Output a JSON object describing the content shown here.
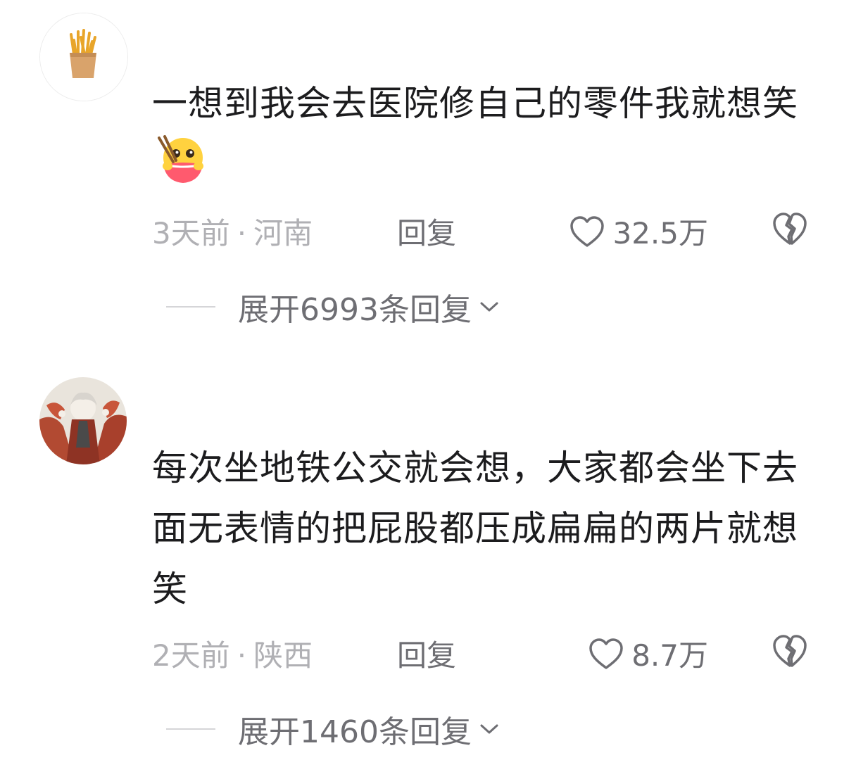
{
  "comments": [
    {
      "avatar_icon": "french-fries-icon",
      "text": "一想到我会去医院修自己的零件我就想笑",
      "emoji_icon": "happy-eating-emoji-icon",
      "time": "3天前",
      "separator": "·",
      "location": "河南",
      "reply_label": "回复",
      "like_count": "32.5万",
      "expand_label": "展开6993条回复"
    },
    {
      "avatar_icon": "anime-character-avatar",
      "text": "每次坐地铁公交就会想，大家都会坐下去面无表情的把屁股都压成扁扁的两片就想笑",
      "time": "2天前",
      "separator": "·",
      "location": "陕西",
      "reply_label": "回复",
      "like_count": "8.7万",
      "expand_label": "展开1460条回复"
    }
  ],
  "colors": {
    "text": "#1c1c1e",
    "meta": "#b0b0b4",
    "action": "#6e6e73"
  }
}
